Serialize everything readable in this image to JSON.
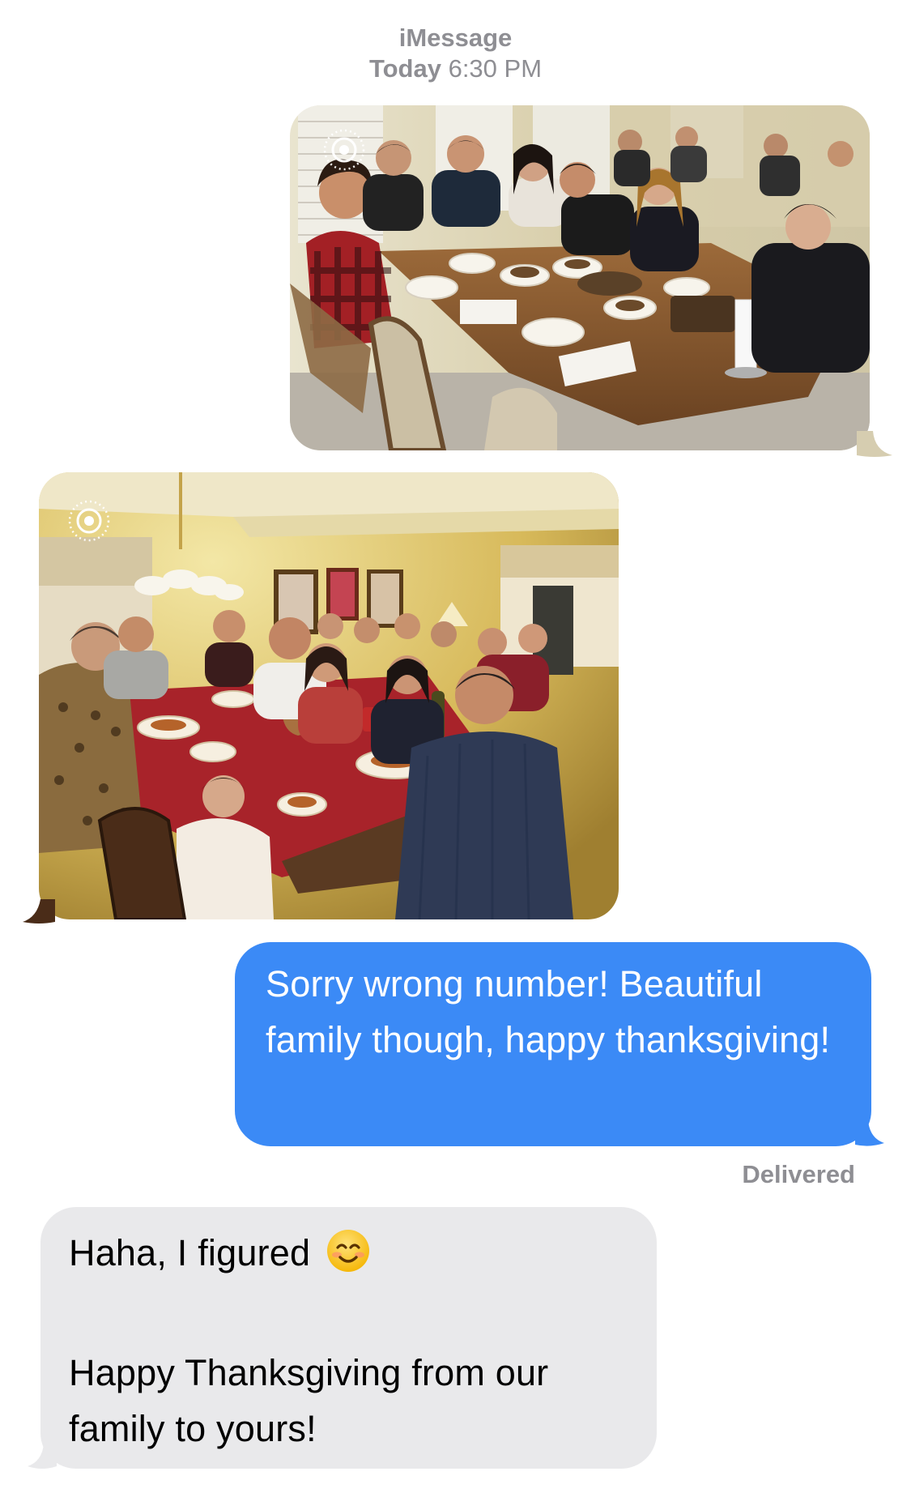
{
  "header": {
    "service": "iMessage",
    "day": "Today",
    "time": "6:30 PM"
  },
  "photos": [
    {
      "icon": "live-photo-icon",
      "sender": "incoming"
    },
    {
      "icon": "live-photo-icon",
      "sender": "incoming"
    }
  ],
  "messages": {
    "sent": {
      "text": "Sorry wrong number! Beautiful family though, happy thanksgiving!",
      "status": "Delivered"
    },
    "received": {
      "line1": "Haha, I figured",
      "emoji": "smiling-face-icon",
      "line2": "Happy Thanksgiving from our family to yours!"
    }
  },
  "colors": {
    "sent_bubble": "#3b8af6",
    "received_bubble": "#e9e9eb",
    "meta_text": "#8e8e93"
  }
}
